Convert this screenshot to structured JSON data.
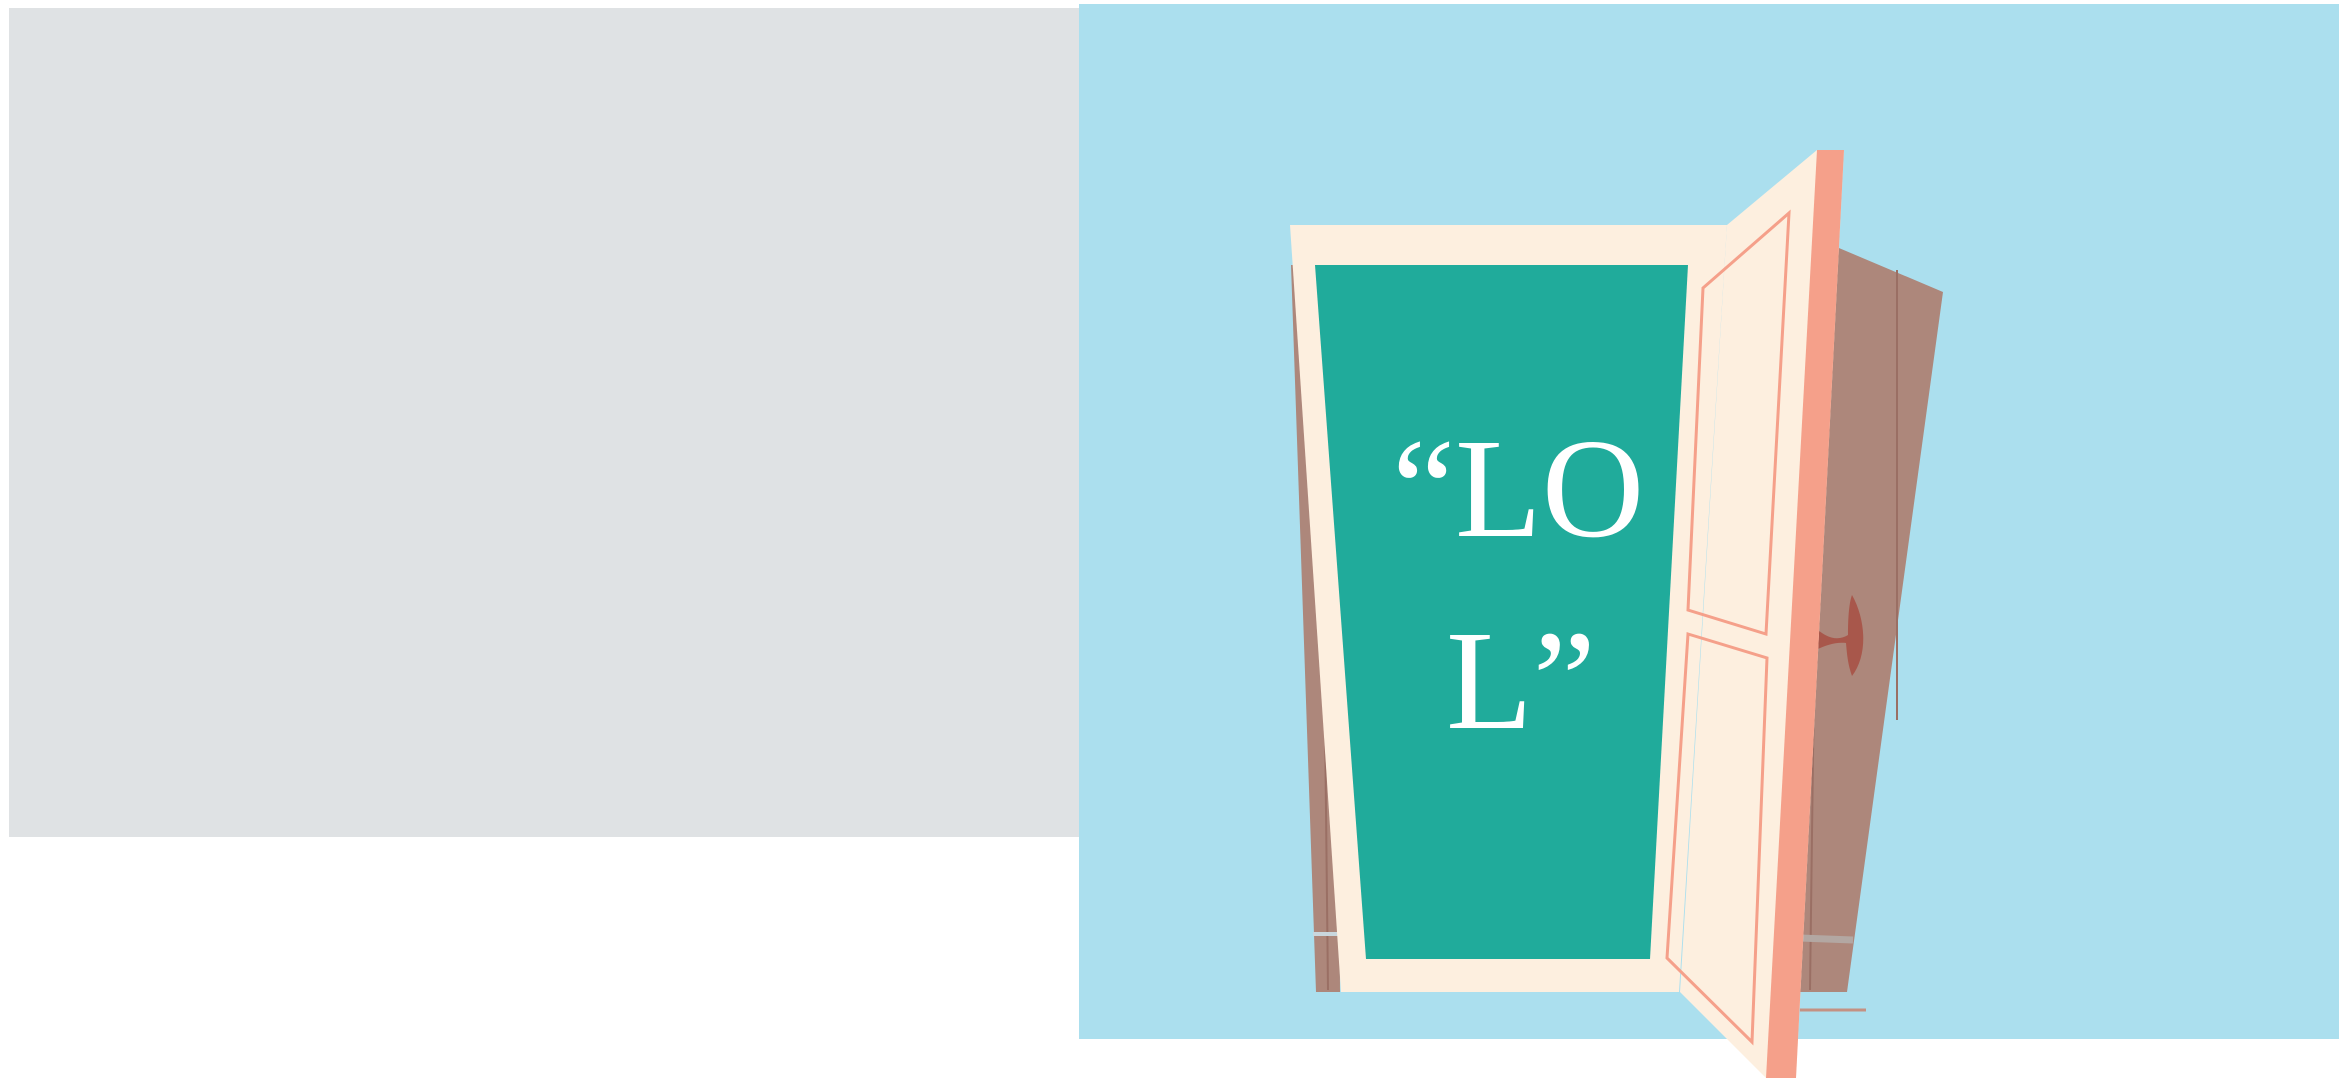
{
  "door_sign": {
    "line1": "“LO",
    "line2": "L”"
  },
  "colors": {
    "gray_panel": "#dfe2e4",
    "sky": "#abdfee",
    "door_frame": "#fdefdf",
    "door_panel": "#20ab9b",
    "door_edge": "#f5a08a",
    "interior": "#ad877b",
    "handle": "#a8574b"
  }
}
